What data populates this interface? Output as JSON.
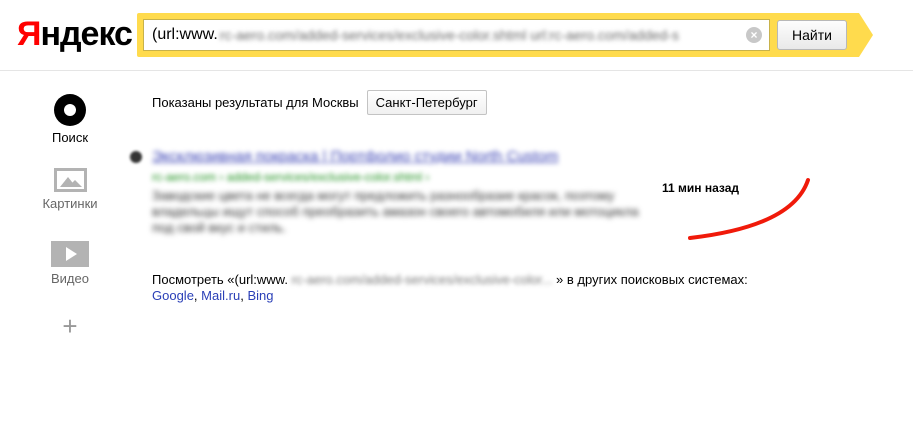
{
  "header": {
    "logo_first": "Я",
    "logo_rest": "ндекс",
    "search_query_visible": "(url:www.",
    "search_query_blurred": "rc-aero.com/added-services/exclusive-color.shtml url:rc-aero.com/added-s",
    "clear_symbol": "×",
    "find_label": "Найти"
  },
  "nav": {
    "search_label": "Поиск",
    "images_label": "Картинки",
    "video_label": "Видео",
    "more_symbol": "+"
  },
  "region": {
    "text": "Показаны результаты для Москвы",
    "button_label": "Санкт-Петербург"
  },
  "result": {
    "title": "Эксклюзивная покраска | Портфолио студии North Custom",
    "url": "rc-aero.com › added-services/exclusive-color.shtml ›",
    "snippet": "Заводские цвета не всегда могут предложить разнообразие красок, поэтому владельцы ищут способ преобразить амазон своего автомобиля или мотоцикла под свой вкус и стиль."
  },
  "annotation": {
    "time_text": "11 мин назад"
  },
  "other_engines": {
    "prefix": "Посмотреть «(url:www.",
    "blurred_query": "rc-aero.com/added-services/exclusive-color...",
    "suffix": "» в других поисковых системах:",
    "google": "Google",
    "mailru": "Mail.ru",
    "bing": "Bing",
    "comma": ","
  },
  "colors": {
    "brand_red": "#ff0000",
    "search_band_yellow": "#ffdb4d",
    "link_blue": "#2a3fb7",
    "url_green": "#1a8f1a",
    "annotation_red": "#f01a0a"
  }
}
